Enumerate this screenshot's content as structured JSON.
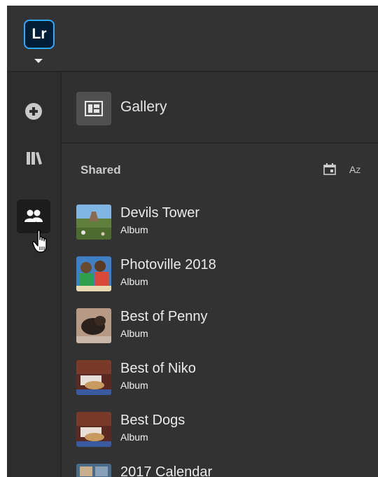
{
  "app": {
    "logo_text": "Lr",
    "accent": "#31a8ff"
  },
  "rail": {
    "items": [
      {
        "icon": "plus-circle-icon",
        "active": false
      },
      {
        "icon": "library-icon",
        "active": false
      },
      {
        "icon": "people-icon",
        "active": true
      }
    ]
  },
  "gallery": {
    "label": "Gallery",
    "icon": "gallery-icon"
  },
  "shared": {
    "heading": "Shared",
    "sort_icons": [
      "calendar-sort-icon",
      "alpha-sort-icon"
    ],
    "sort_az": {
      "big": "A",
      "small": "Z"
    },
    "albums": [
      {
        "name": "Devils Tower",
        "type": "Album"
      },
      {
        "name": "Photoville 2018",
        "type": "Album"
      },
      {
        "name": "Best of Penny",
        "type": "Album"
      },
      {
        "name": "Best of Niko",
        "type": "Album"
      },
      {
        "name": "Best Dogs",
        "type": "Album"
      },
      {
        "name": "2017 Calendar",
        "type": ""
      }
    ]
  }
}
